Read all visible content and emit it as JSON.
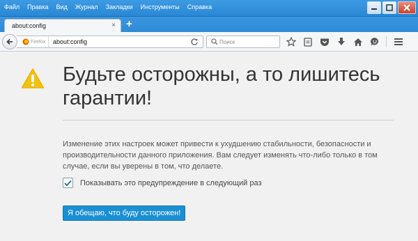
{
  "menu": {
    "items": [
      "Файл",
      "Правка",
      "Вид",
      "Журнал",
      "Закладки",
      "Инструменты",
      "Справка"
    ]
  },
  "tab": {
    "title": "about:config",
    "close": "×",
    "new_tab": "+"
  },
  "navbar": {
    "identity_label": "Firefox",
    "url": "about:config",
    "search_placeholder": "Поиск"
  },
  "page": {
    "heading": "Будьте осторожны, а то лишитесь гарантии!",
    "description": "Изменение этих настроек может привести к ухудшению стабильности, безопасности и производительности данного приложения. Вам следует изменять что-либо только в том случае, если вы уверены в том, что делаете.",
    "checkbox_label": "Показывать это предупреждение в следующий раз",
    "checkbox_checked": true,
    "button_label": "Я обещаю, что буду осторожен!"
  },
  "colors": {
    "chrome_blue": "#2f8bd6",
    "button_blue": "#1a8fd4",
    "warning_yellow": "#f3c20f"
  }
}
